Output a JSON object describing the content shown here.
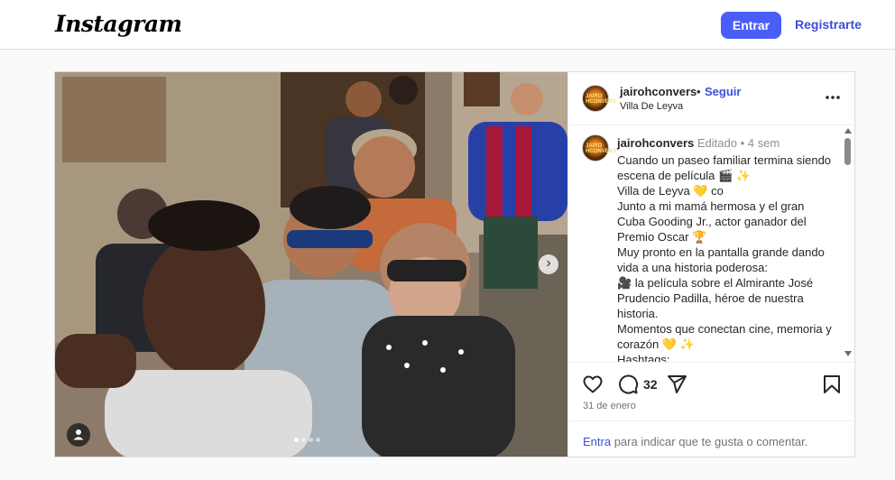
{
  "app": {
    "logo": "Instagram"
  },
  "nav": {
    "login_label": "Entrar",
    "register_label": "Registrarte"
  },
  "post": {
    "avatar_text": "JAIRO HCONVERS",
    "username": "jairohconvers",
    "separator": "•",
    "follow_label": "Seguir",
    "location": "Villa De Leyva",
    "caption": {
      "username": "jairohconvers",
      "edited": "Editado",
      "separator": "•",
      "time": "4 sem",
      "lines": [
        "Cuando un paseo familiar termina siendo escena de película 🎬 ✨",
        "Villa de Leyva 💛 co",
        "Junto a mi mamá hermosa y el gran Cuba Gooding Jr., actor ganador del Premio Oscar 🏆",
        "Muy pronto en la pantalla grande dando vida a una historia poderosa:",
        "🎥 la película sobre el Almirante José Prudencio Padilla, héroe de nuestra historia.",
        "Momentos que conectan cine, memoria y corazón 💛 ✨",
        "Hashtags:"
      ]
    },
    "comment_count": "32",
    "date": "31 de enero",
    "login_prompt": {
      "link": "Entra",
      "text": " para indicar que te gusta o comentar."
    },
    "carousel": {
      "total": 4,
      "active": 1
    }
  },
  "icons": {
    "like": "heart-icon",
    "comment": "comment-icon",
    "share": "share-icon",
    "save": "bookmark-icon",
    "more": "more-options-icon",
    "next": "chevron-right-icon",
    "tag": "user-tag-icon"
  },
  "colors": {
    "primary": "#4a5df9",
    "link": "#3b4ed8",
    "muted": "#737373"
  }
}
